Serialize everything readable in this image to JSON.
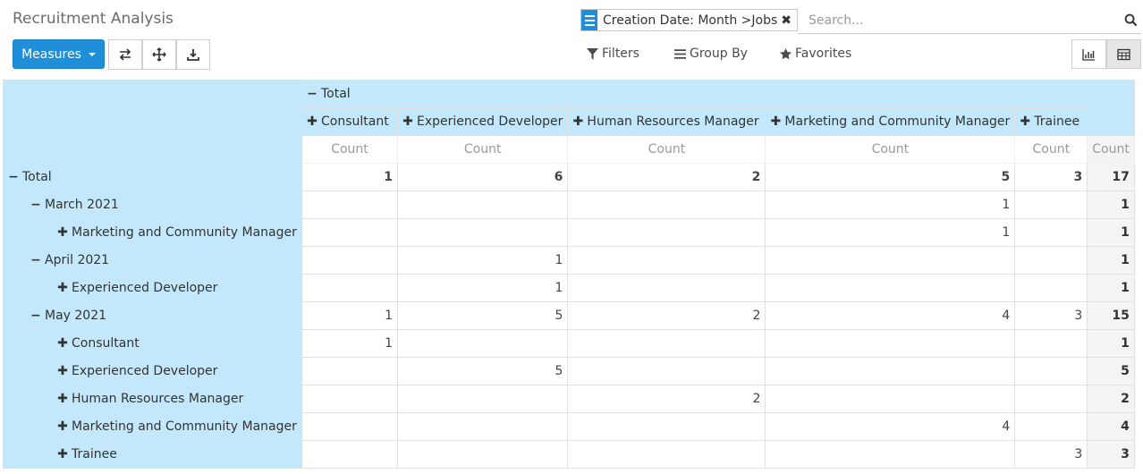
{
  "title": "Recruitment Analysis",
  "toolbar": {
    "measures_label": "Measures",
    "flip_icon": "flip-axis-icon",
    "expand_icon": "expand-all-icon",
    "download_icon": "download-icon"
  },
  "search": {
    "facet_label": "Creation Date: Month",
    "facet_separator": ">",
    "facet_value": "Jobs",
    "facet_remove_icon": "close-icon",
    "placeholder": "Search..."
  },
  "filters": {
    "filters_label": "Filters",
    "groupby_label": "Group By",
    "favorites_label": "Favorites"
  },
  "views": {
    "graph_icon": "bar-chart-icon",
    "pivot_icon": "table-icon",
    "active": "pivot"
  },
  "colors": {
    "primary": "#1f8fd9",
    "header_bg": "#c4e8fb"
  },
  "pivot": {
    "col_total_label": "Total",
    "col_headers": [
      "Consultant",
      "Experienced Developer",
      "Human Resources Manager",
      "Marketing and Community Manager",
      "Trainee"
    ],
    "measure_label": "Count",
    "rows": [
      {
        "label": "Total",
        "level": 0,
        "expanded": true,
        "values": [
          "1",
          "6",
          "2",
          "5",
          "3"
        ],
        "total": "17"
      },
      {
        "label": "March 2021",
        "level": 1,
        "expanded": true,
        "values": [
          "",
          "",
          "",
          "1",
          ""
        ],
        "total": "1"
      },
      {
        "label": "Marketing and Community Manager",
        "level": 2,
        "expanded": false,
        "values": [
          "",
          "",
          "",
          "1",
          ""
        ],
        "total": "1"
      },
      {
        "label": "April 2021",
        "level": 1,
        "expanded": true,
        "values": [
          "",
          "1",
          "",
          "",
          ""
        ],
        "total": "1"
      },
      {
        "label": "Experienced Developer",
        "level": 2,
        "expanded": false,
        "values": [
          "",
          "1",
          "",
          "",
          ""
        ],
        "total": "1"
      },
      {
        "label": "May 2021",
        "level": 1,
        "expanded": true,
        "values": [
          "1",
          "5",
          "2",
          "4",
          "3"
        ],
        "total": "15"
      },
      {
        "label": "Consultant",
        "level": 2,
        "expanded": false,
        "values": [
          "1",
          "",
          "",
          "",
          ""
        ],
        "total": "1"
      },
      {
        "label": "Experienced Developer",
        "level": 2,
        "expanded": false,
        "values": [
          "",
          "5",
          "",
          "",
          ""
        ],
        "total": "5"
      },
      {
        "label": "Human Resources Manager",
        "level": 2,
        "expanded": false,
        "values": [
          "",
          "",
          "2",
          "",
          ""
        ],
        "total": "2"
      },
      {
        "label": "Marketing and Community Manager",
        "level": 2,
        "expanded": false,
        "values": [
          "",
          "",
          "",
          "4",
          ""
        ],
        "total": "4"
      },
      {
        "label": "Trainee",
        "level": 2,
        "expanded": false,
        "values": [
          "",
          "",
          "",
          "",
          "3"
        ],
        "total": "3"
      }
    ]
  }
}
